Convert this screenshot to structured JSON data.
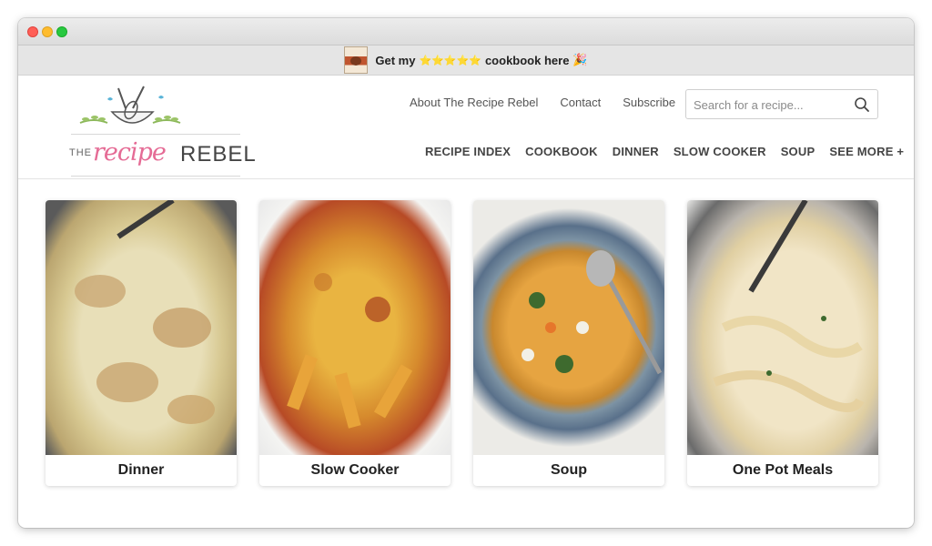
{
  "promo": {
    "text_before": "Get my",
    "stars": "⭐⭐⭐⭐⭐",
    "text_after": "cookbook here",
    "emoji": "🎉"
  },
  "logo": {
    "the": "THE",
    "recipe": "recipe",
    "rebel": "REBEL"
  },
  "toplinks": [
    {
      "label": "About The Recipe Rebel"
    },
    {
      "label": "Contact"
    },
    {
      "label": "Subscribe"
    }
  ],
  "search": {
    "placeholder": "Search for a recipe..."
  },
  "mainnav": [
    {
      "label": "RECIPE INDEX"
    },
    {
      "label": "COOKBOOK"
    },
    {
      "label": "DINNER"
    },
    {
      "label": "SLOW COOKER"
    },
    {
      "label": "SOUP"
    },
    {
      "label": "SEE MORE +"
    }
  ],
  "cards": [
    {
      "label": "Dinner"
    },
    {
      "label": "Slow Cooker"
    },
    {
      "label": "Soup"
    },
    {
      "label": "One Pot Meals"
    }
  ],
  "colors": {
    "brand_pink": "#e56b95",
    "promo_bg": "#e5e5e5",
    "text_dark": "#222222"
  }
}
